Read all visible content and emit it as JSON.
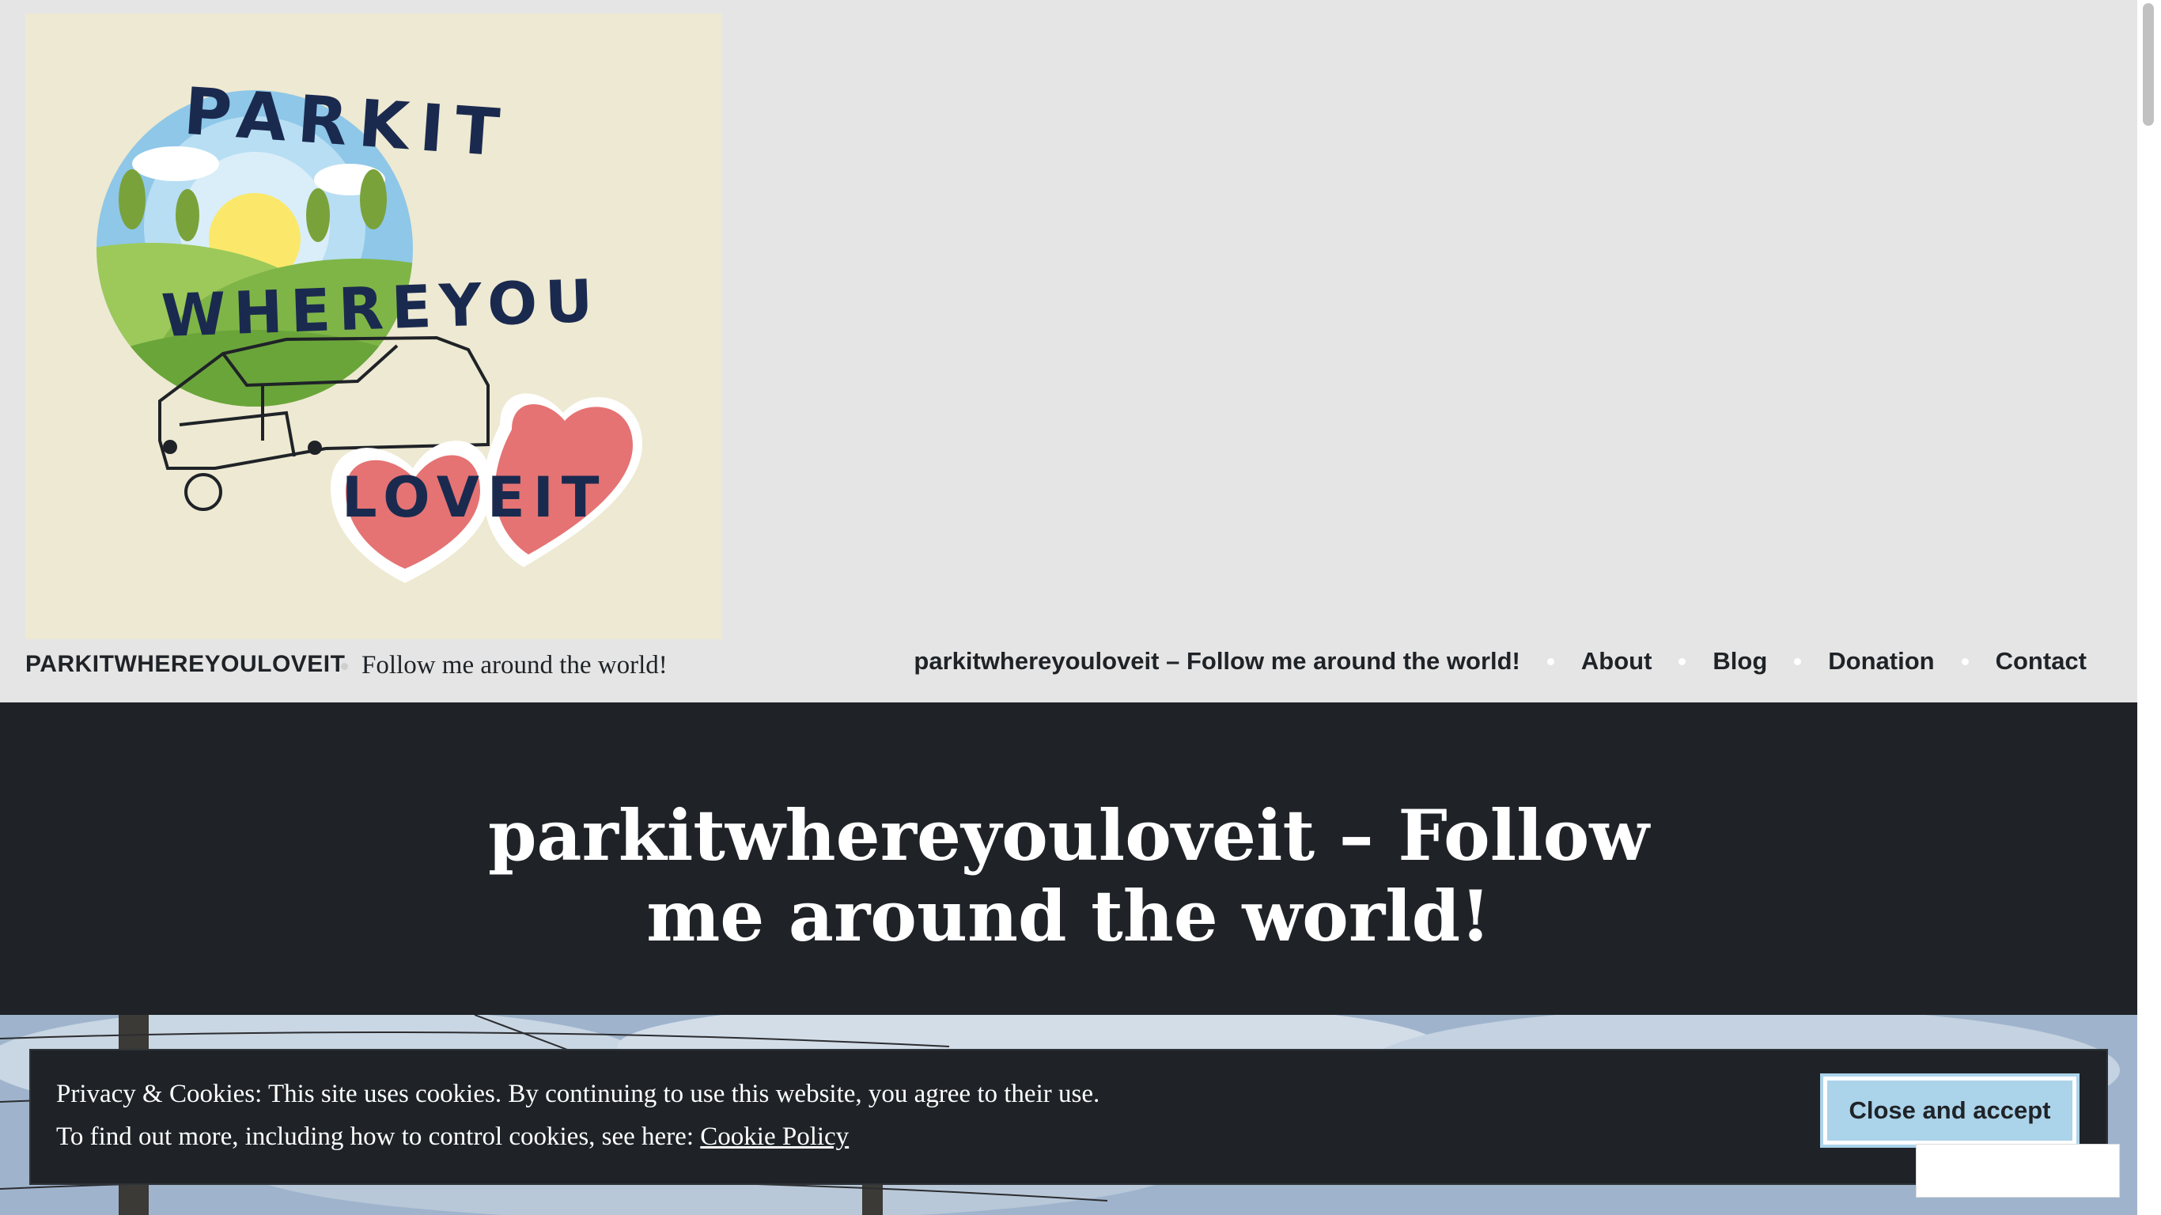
{
  "site": {
    "title": "PARKITWHEREYOULOVEIT",
    "tagline": "Follow me around the world!",
    "logo_words": [
      "PARKIT",
      "WHEREYOU",
      "LOVEIT"
    ]
  },
  "nav": {
    "items": [
      {
        "label": "parkitwhereyouloveit – Follow me around the world!"
      },
      {
        "label": "About"
      },
      {
        "label": "Blog"
      },
      {
        "label": "Donation"
      },
      {
        "label": "Contact"
      }
    ]
  },
  "hero": {
    "title": "parkitwhereyouloveit – Follow me around the world!"
  },
  "cookie": {
    "line1": "Privacy & Cookies: This site uses cookies. By continuing to use this website, you agree to their use.",
    "line2_prefix": "To find out more, including how to control cookies, see here: ",
    "link_label": "Cookie Policy",
    "button_label": "Close and accept"
  },
  "colors": {
    "header_bg": "#e5e5e5",
    "dark": "#1f2327",
    "accent_button": "#abd3ea",
    "logo_bg": "#eee9d2",
    "heart": "#e57373",
    "navy_text": "#1a2a4f"
  }
}
